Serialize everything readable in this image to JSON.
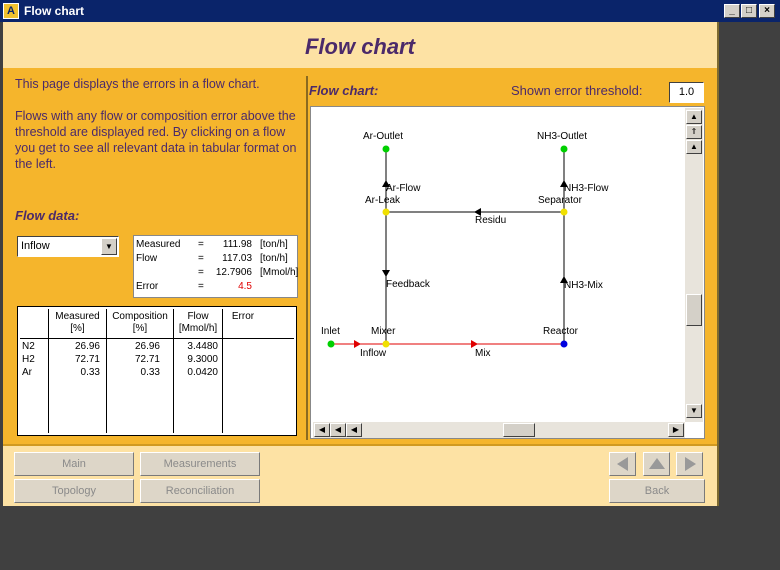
{
  "window": {
    "title": "Flow chart",
    "app_icon": "A"
  },
  "header": {
    "title": "Flow chart"
  },
  "left": {
    "description_1": "This page displays the errors in a flow chart.",
    "description_2": "Flows with any flow or composition error above the threshold are displayed red. By clicking on a flow you get to see all relevant data in tabular format on the left.",
    "flow_data_label": "Flow data:",
    "selected_flow": "Inflow",
    "summary": [
      {
        "label": "Measured",
        "eq": "=",
        "value": "111.98",
        "unit": "[ton/h]"
      },
      {
        "label": "Flow",
        "eq": "=",
        "value": "117.03",
        "unit": "[ton/h]"
      },
      {
        "label": "",
        "eq": "=",
        "value": "12.7906",
        "unit": "[Mmol/h]"
      },
      {
        "label": "Error",
        "eq": "=",
        "value": "4.5",
        "unit": ""
      }
    ],
    "table": {
      "headers": [
        "",
        "Measured [%]",
        "Composition [%]",
        "Flow [Mmol/h]",
        "Error"
      ],
      "rows": [
        [
          "N2",
          "26.96",
          "26.96",
          "3.4480",
          ""
        ],
        [
          "H2",
          "72.71",
          "72.71",
          "9.3000",
          ""
        ],
        [
          "Ar",
          "0.33",
          "0.33",
          "0.0420",
          ""
        ]
      ]
    }
  },
  "right": {
    "flow_chart_label": "Flow chart:",
    "threshold_label": "Shown error threshold:",
    "threshold_value": "1.0",
    "nodes": {
      "ar_outlet": "Ar-Outlet",
      "nh3_outlet": "NH3-Outlet",
      "ar_leak": "Ar-Leak",
      "separator": "Separator",
      "inlet": "Inlet",
      "mixer": "Mixer",
      "reactor": "Reactor"
    },
    "streams": {
      "ar_flow": "Ar-Flow",
      "nh3_flow": "NH3-Flow",
      "residu": "Residu",
      "feedback": "Feedback",
      "nh3_mix": "NH3-Mix",
      "inflow": "Inflow",
      "mix": "Mix"
    },
    "colors": {
      "ok": "#000000",
      "error": "#e00000",
      "node_green": "#00d000",
      "node_yellow": "#f0e000",
      "node_blue": "#0000e0"
    }
  },
  "nav": {
    "main": "Main",
    "measurements": "Measurements",
    "topology": "Topology",
    "reconciliation": "Reconciliation",
    "back": "Back"
  }
}
